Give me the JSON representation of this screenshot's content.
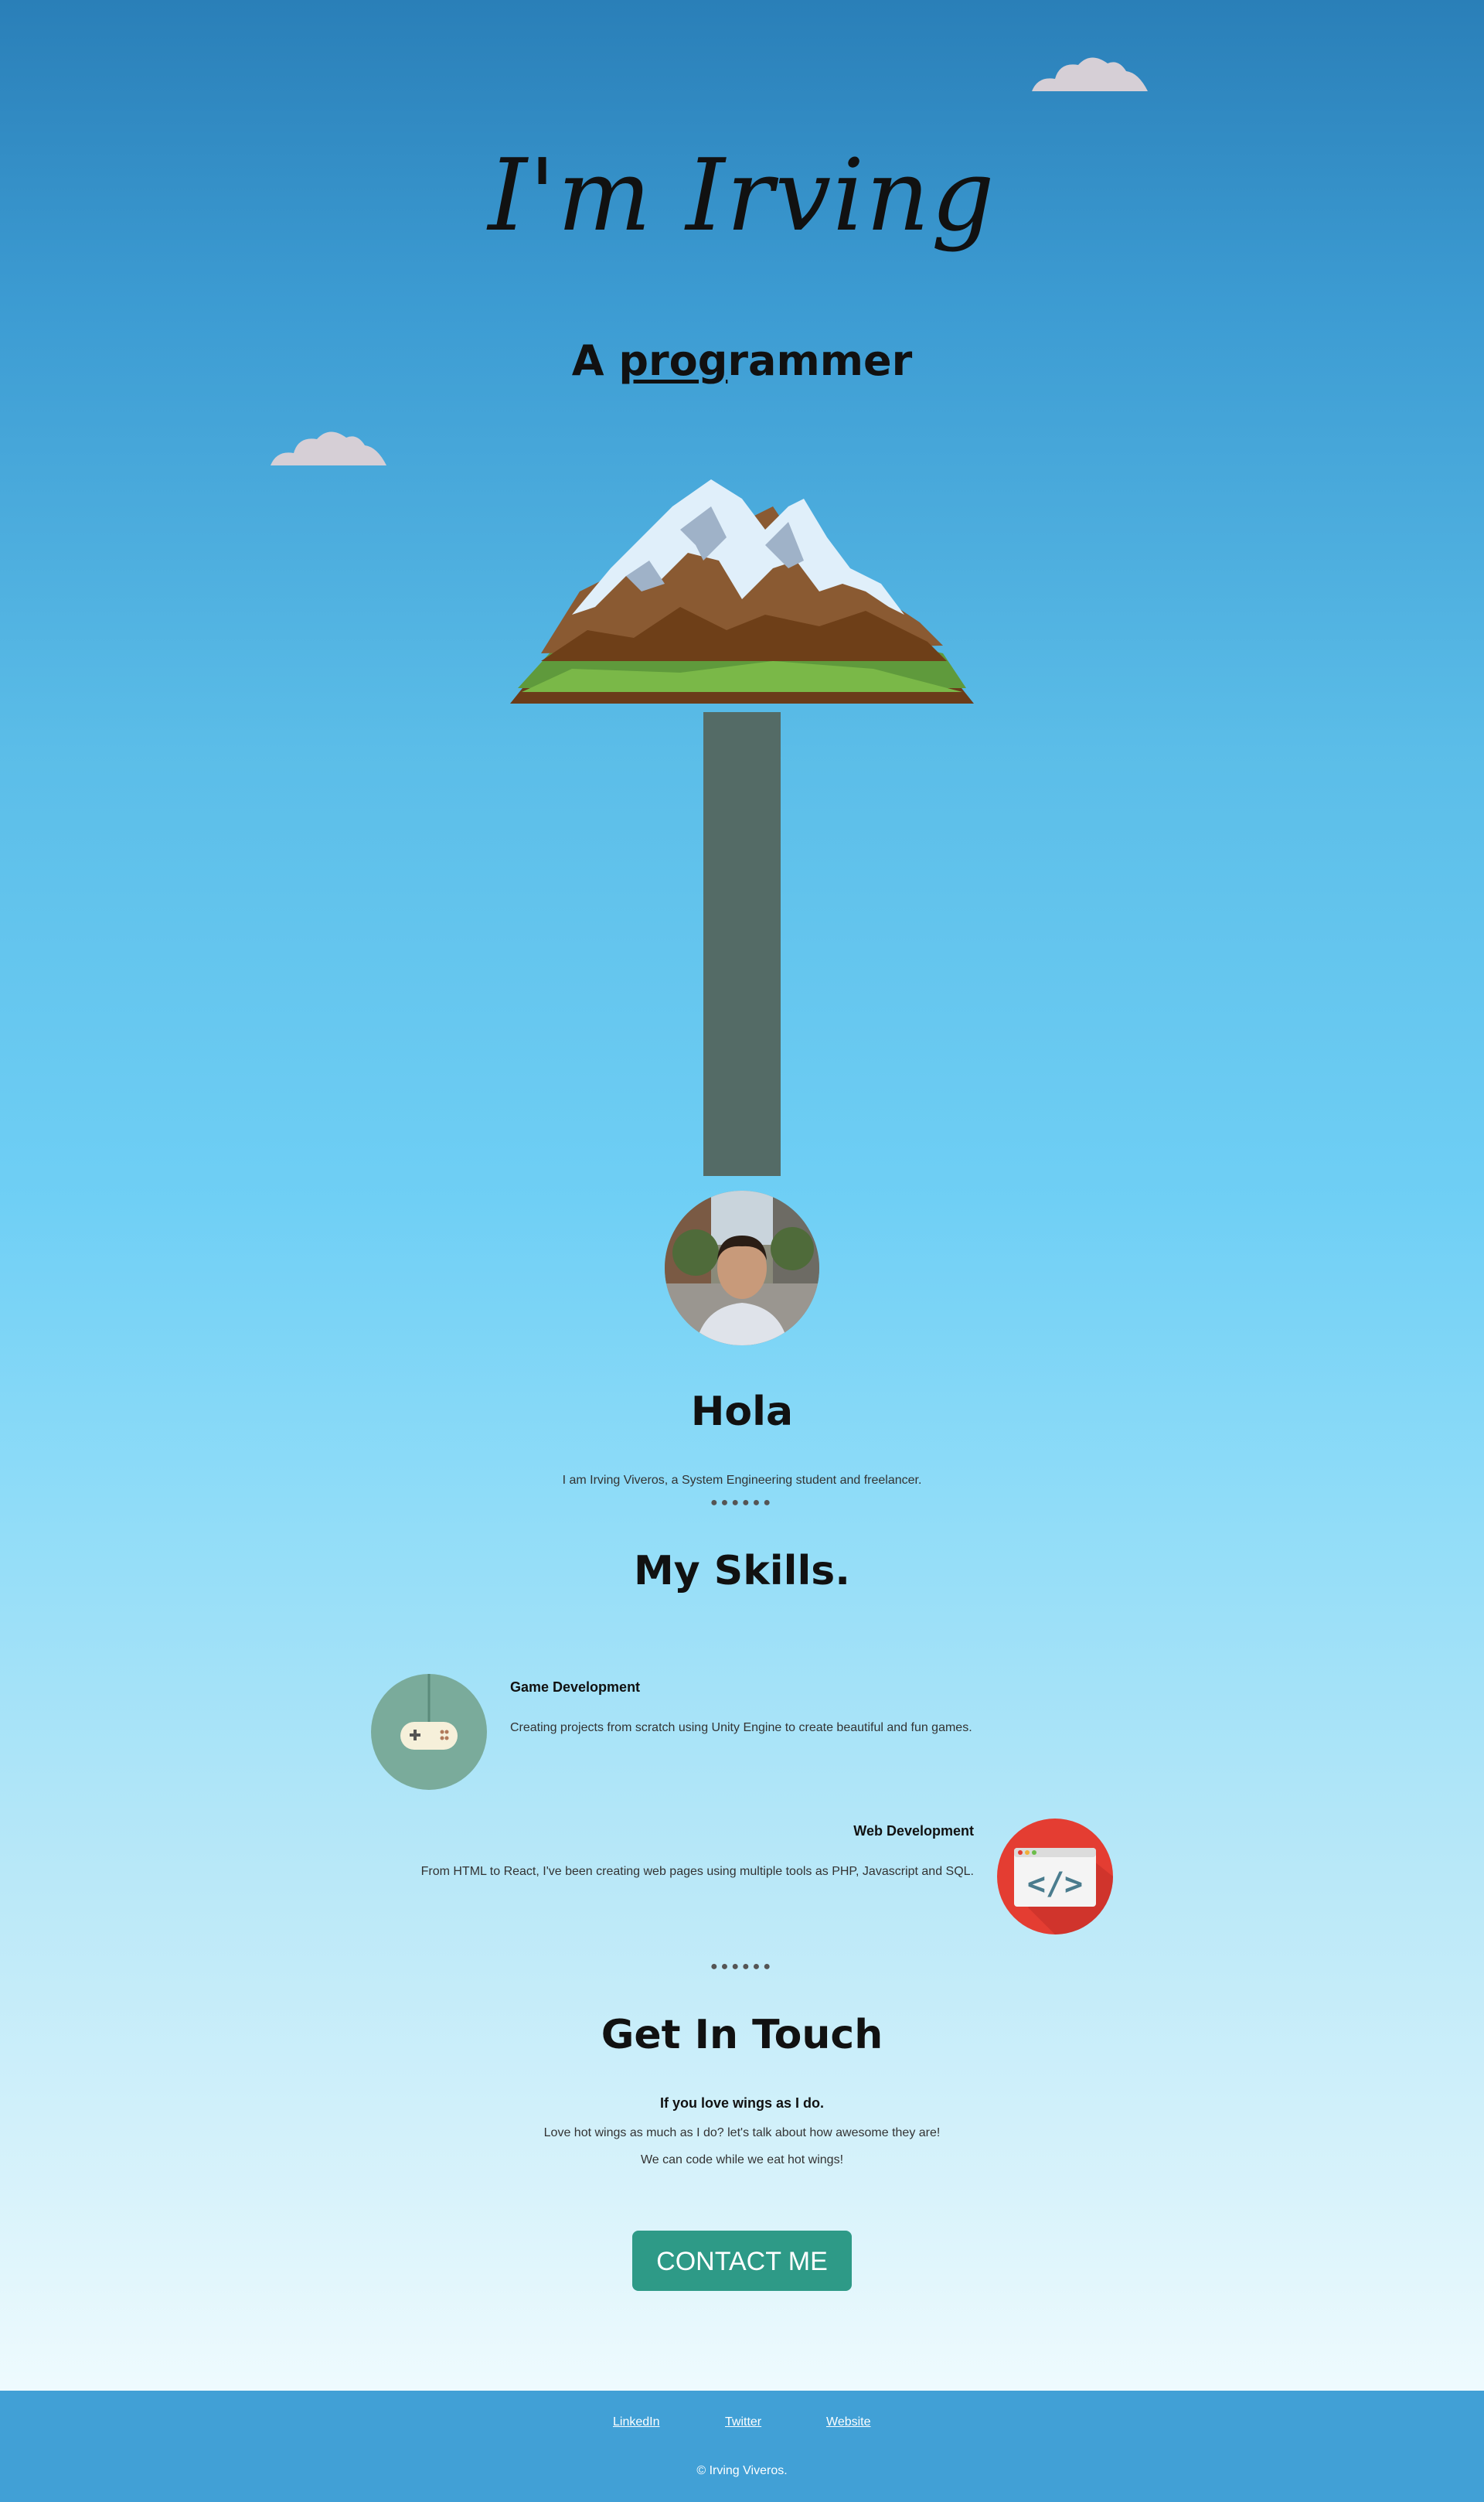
{
  "hero": {
    "title": "I'm Irving",
    "subtitle_prefix": "A ",
    "subtitle_underlined": "prog",
    "subtitle_rest": "rammer"
  },
  "about": {
    "heading": "Hola",
    "text": "I am Irving Viveros, a System Engineering student and freelancer.",
    "dots": "●●●●●●"
  },
  "skills": {
    "heading": "My Skills.",
    "items": [
      {
        "title": "Game Development",
        "description": "Creating projects from scratch using Unity Engine to create beautiful and fun games.",
        "icon": "gamepad-icon"
      },
      {
        "title": "Web Development",
        "description": "From HTML to React, I've been creating web pages using multiple tools as PHP, Javascript and SQL.",
        "icon": "code-window-icon"
      }
    ],
    "dots": "●●●●●●"
  },
  "contact": {
    "heading": "Get In Touch",
    "lead": "If you love wings as I do.",
    "line1": "Love hot wings as much as I do? let's talk about how awesome they are!",
    "line2": "We can code while we eat hot wings!",
    "button": "CONTACT ME"
  },
  "footer": {
    "links": [
      "LinkedIn",
      "Twitter",
      "Website"
    ],
    "copyright": "© Irving Viveros."
  },
  "colors": {
    "pole": "#546b66",
    "button": "#2e9a87",
    "footer": "#41a0d6",
    "skill_game_bg": "#7aab9b",
    "skill_web_bg": "#e43d32"
  }
}
